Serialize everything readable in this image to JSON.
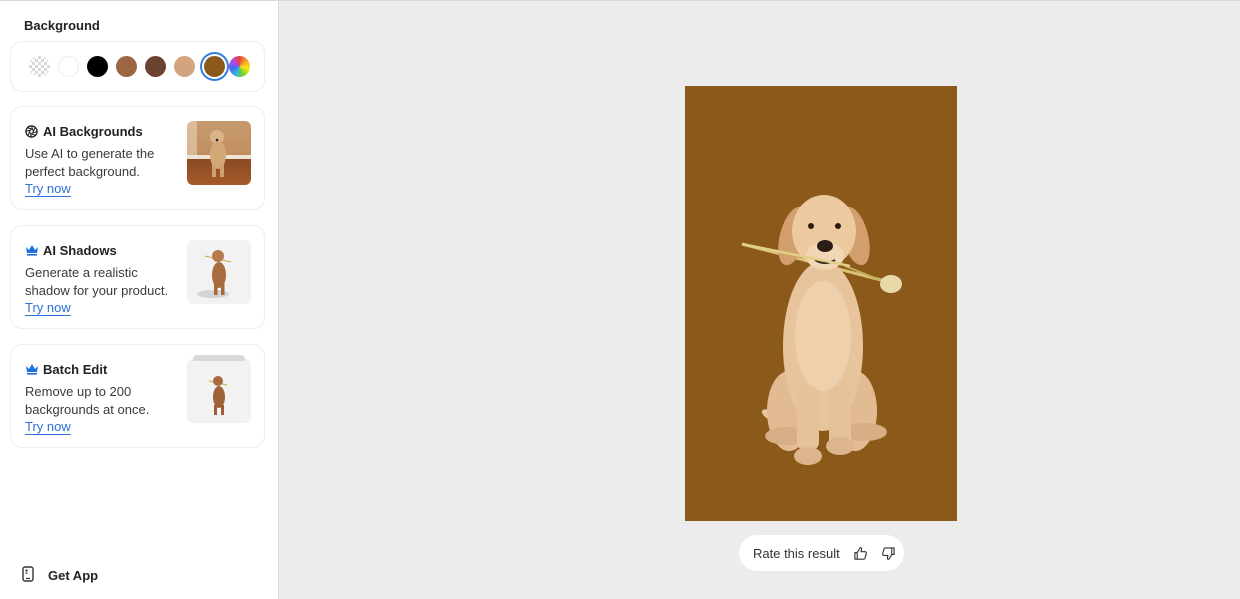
{
  "sidebar": {
    "background_title": "Background",
    "swatches": [
      {
        "name": "transparent",
        "color": "transparent",
        "selected": false
      },
      {
        "name": "white",
        "color": "#ffffff",
        "selected": false
      },
      {
        "name": "black",
        "color": "#000000",
        "selected": false
      },
      {
        "name": "brown",
        "color": "#9b6641",
        "selected": false
      },
      {
        "name": "dark-brown",
        "color": "#6a4333",
        "selected": false
      },
      {
        "name": "tan",
        "color": "#d4a47f",
        "selected": false
      },
      {
        "name": "ochre",
        "color": "#8b5a1a",
        "selected": true
      },
      {
        "name": "custom-color-picker",
        "color": "rainbow",
        "selected": false
      }
    ],
    "cards": [
      {
        "icon": "aperture-icon",
        "title": "AI Backgrounds",
        "description": "Use AI to generate the perfect background.",
        "link": "Try now"
      },
      {
        "icon": "crown-icon",
        "title": "AI Shadows",
        "description": "Generate a realistic shadow for your product.",
        "link": "Try now"
      },
      {
        "icon": "crown-icon",
        "title": "Batch Edit",
        "description": "Remove up to 200 backgrounds at once.",
        "link": "Try now"
      }
    ],
    "get_app": {
      "icon": "phone-icon",
      "label": "Get App"
    }
  },
  "canvas": {
    "background_color": "#8b5a1a",
    "image_subject": "Golden retriever puppy holding a tulip"
  },
  "rating": {
    "label": "Rate this result",
    "thumbs_up_icon": "thumbs-up-icon",
    "thumbs_down_icon": "thumbs-down-icon"
  },
  "colors": {
    "accent": "#2f7de1",
    "link": "#2f6fd6",
    "premium": "#1f6fe0"
  }
}
